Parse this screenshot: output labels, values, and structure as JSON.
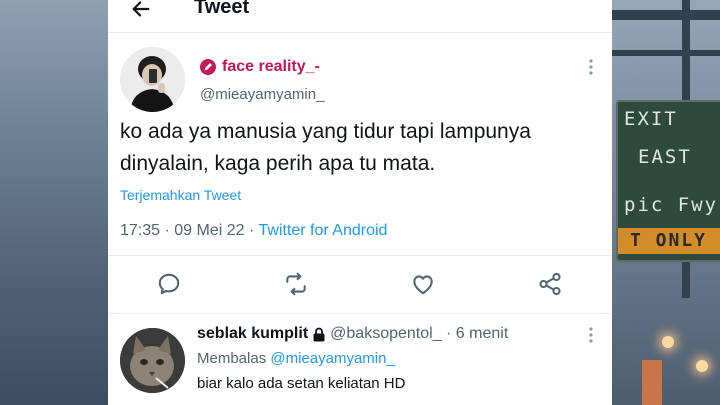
{
  "header": {
    "title": "Tweet",
    "back_icon": "arrow-left-icon"
  },
  "tweet": {
    "display_name": "face reality_-",
    "handle": "@mieayamyamin_",
    "text": "ko ada ya manusia yang tidur tapi lampunya dinyalain, kaga perih apa tu mata.",
    "translate_label": "Terjemahkan Tweet",
    "time": "17:35",
    "date": "09 Mei 22",
    "source": "Twitter for Android",
    "name_color": "#c2185b"
  },
  "actions": [
    {
      "icon": "reply-icon"
    },
    {
      "icon": "retweet-icon"
    },
    {
      "icon": "like-icon"
    },
    {
      "icon": "share-icon"
    }
  ],
  "reply": {
    "display_name": "seblak kumplit",
    "handle_time": "@baksopentol_ · 6 menit",
    "replying_prefix": "Membalas",
    "replying_mention": "@mieayamyamin_",
    "text": "biar kalo ada setan keliatan HD"
  },
  "background": {
    "sign_lines": [
      "EXIT",
      "EAST",
      "pic Fwy"
    ],
    "sign_strip": "T ONLY"
  },
  "colors": {
    "accent": "#1d9bf0",
    "text": "#0f1419",
    "muted": "#536471"
  }
}
